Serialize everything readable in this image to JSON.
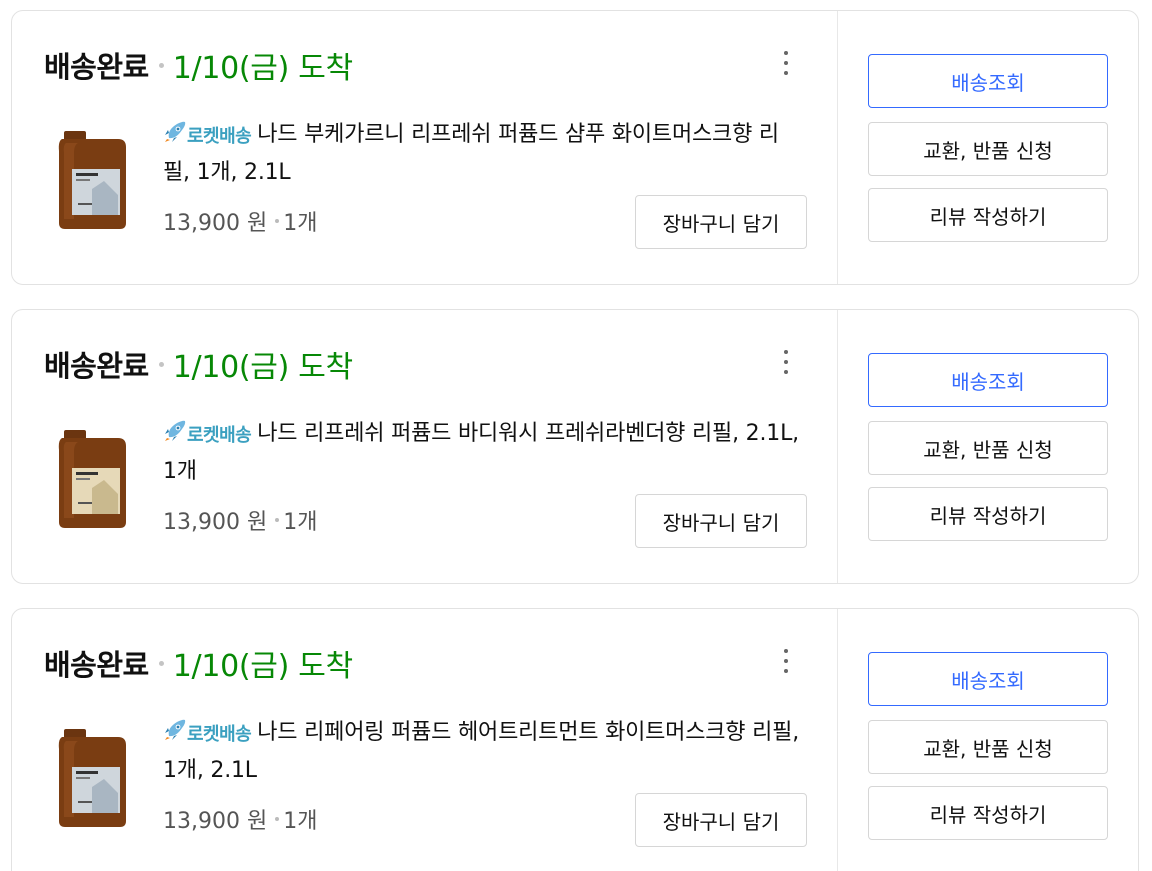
{
  "orders": [
    {
      "status": "배송완료",
      "arrival": "1/10(금) 도착",
      "rocket_label": "로켓배송",
      "product_name": "나드 부케가르니 리프레쉬 퍼퓸드 샴푸 화이트머스크향 리필, 1개, 2.1L",
      "price": "13,900 원",
      "quantity": "1개",
      "cart_button": "장바구니 담기",
      "track_button": "배송조회",
      "return_button": "교환, 반품 신청",
      "review_button": "리뷰 작성하기",
      "label_color": "#cfd6dc"
    },
    {
      "status": "배송완료",
      "arrival": "1/10(금) 도착",
      "rocket_label": "로켓배송",
      "product_name": "나드 리프레쉬 퍼퓸드 바디워시 프레쉬라벤더향 리필, 2.1L, 1개",
      "price": "13,900 원",
      "quantity": "1개",
      "cart_button": "장바구니 담기",
      "track_button": "배송조회",
      "return_button": "교환, 반품 신청",
      "review_button": "리뷰 작성하기",
      "label_color": "#e6d9b8"
    },
    {
      "status": "배송완료",
      "arrival": "1/10(금) 도착",
      "rocket_label": "로켓배송",
      "product_name": "나드 리페어링 퍼퓸드 헤어트리트먼트 화이트머스크향 리필, 1개, 2.1L",
      "price": "13,900 원",
      "quantity": "1개",
      "cart_button": "장바구니 담기",
      "track_button": "배송조회",
      "return_button": "교환, 반품 신청",
      "review_button": "리뷰 작성하기",
      "label_color": "#cfd6dc"
    }
  ],
  "colors": {
    "arrival_green": "#078806",
    "accent_blue": "#346aff",
    "rocket_blue": "#3ba0c0"
  },
  "icons": {
    "more": "more-vertical-icon",
    "rocket": "rocket-icon"
  }
}
